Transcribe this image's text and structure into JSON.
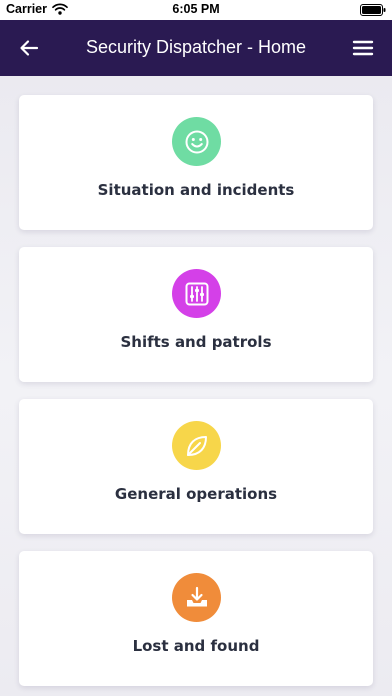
{
  "status_bar": {
    "carrier": "Carrier",
    "time": "6:05 PM",
    "icons": [
      "wifi-icon",
      "battery-icon"
    ]
  },
  "header": {
    "title": "Security Dispatcher - Home",
    "back_icon": "arrow-left-icon",
    "menu_icon": "hamburger-menu-icon",
    "background_color": "#2a1a52"
  },
  "cards": [
    {
      "label": "Situation and incidents",
      "icon": "smiley-face-icon",
      "color": "#6fdca3"
    },
    {
      "label": "Shifts and patrols",
      "icon": "sliders-icon",
      "color": "#d440e8"
    },
    {
      "label": "General operations",
      "icon": "leaf-icon",
      "color": "#f7d64a"
    },
    {
      "label": "Lost and found",
      "icon": "download-tray-icon",
      "color": "#f08c3a"
    }
  ]
}
